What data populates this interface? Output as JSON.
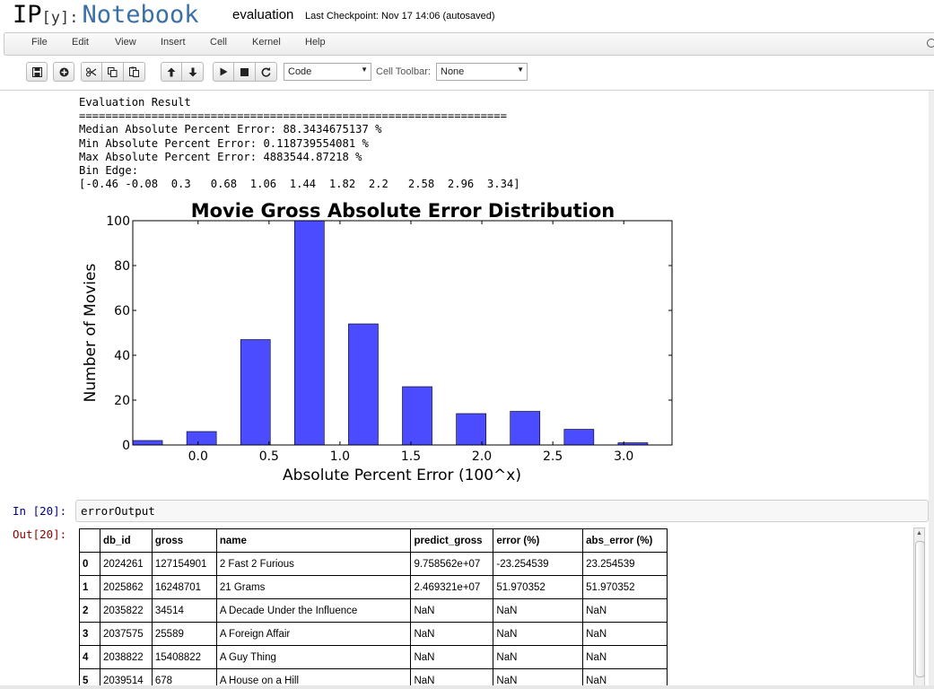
{
  "header": {
    "logo_ip": "IP",
    "logo_y": "[y]:",
    "logo_notebook": "Notebook",
    "notebook_name": "evaluation",
    "checkpoint": "Last Checkpoint: Nov 17 14:06 (autosaved)"
  },
  "menubar": {
    "items": [
      "File",
      "Edit",
      "View",
      "Insert",
      "Cell",
      "Kernel",
      "Help"
    ]
  },
  "toolbar": {
    "buttons": [
      "save-icon",
      "plus-icon",
      "scissors-icon",
      "copy-icon",
      "paste-icon",
      "arrow-up-icon",
      "arrow-down-icon",
      "play-icon",
      "stop-icon",
      "refresh-icon"
    ],
    "cell_type": "Code",
    "cell_toolbar_label": "Cell Toolbar:",
    "cell_toolbar_value": "None"
  },
  "output": {
    "lines": [
      "Evaluation Result",
      "=================================================================",
      "Median Absolute Percent Error: 88.3434675137 %",
      "Min Absolute Percent Error: 0.118739554081 %",
      "Max Absolute Percent Error: 4883544.87218 %",
      "Bin Edge:",
      "[-0.46 -0.08  0.3   0.68  1.06  1.44  1.82  2.2   2.58  2.96  3.34]"
    ]
  },
  "chart_data": {
    "type": "bar",
    "title": "Movie Gross Absolute Error Distribution",
    "xlabel": "Absolute Percent Error (100^x)",
    "ylabel": "Number of Movies",
    "bin_edges": [
      -0.46,
      -0.08,
      0.3,
      0.68,
      1.06,
      1.44,
      1.82,
      2.2,
      2.58,
      2.96,
      3.34
    ],
    "values": [
      2,
      6,
      47,
      100,
      54,
      26,
      14,
      15,
      7,
      1
    ],
    "xlim": [
      -0.46,
      3.34
    ],
    "ylim": [
      0,
      100
    ],
    "xticks": [
      0.0,
      0.5,
      1.0,
      1.5,
      2.0,
      2.5,
      3.0
    ],
    "xtick_labels": [
      "0.0",
      "0.5",
      "1.0",
      "1.5",
      "2.0",
      "2.5",
      "3.0"
    ],
    "yticks": [
      0,
      20,
      40,
      60,
      80,
      100
    ],
    "ytick_labels": [
      "0",
      "20",
      "40",
      "60",
      "80",
      "100"
    ],
    "bar_color": "#4b4bff",
    "grid": false
  },
  "cell": {
    "in_prompt": "In [20]:",
    "input": "errorOutput",
    "out_prompt": "Out[20]:"
  },
  "table": {
    "columns": [
      "",
      "db_id",
      "gross",
      "name",
      "predict_gross",
      "error (%)",
      "abs_error (%)"
    ],
    "rows": [
      [
        "0",
        "2024261",
        "127154901",
        "2 Fast 2 Furious",
        "9.758562e+07",
        "-23.254539",
        "23.254539"
      ],
      [
        "1",
        "2025862",
        "16248701",
        "21 Grams",
        "2.469321e+07",
        "51.970352",
        "51.970352"
      ],
      [
        "2",
        "2035822",
        "34514",
        "A Decade Under the Influence",
        "NaN",
        "NaN",
        "NaN"
      ],
      [
        "3",
        "2037575",
        "25589",
        "A Foreign Affair",
        "NaN",
        "NaN",
        "NaN"
      ],
      [
        "4",
        "2038822",
        "15408822",
        "A Guy Thing",
        "NaN",
        "NaN",
        "NaN"
      ],
      [
        "5",
        "2039514",
        "678",
        "A House on a Hill",
        "NaN",
        "NaN",
        "NaN"
      ]
    ]
  }
}
